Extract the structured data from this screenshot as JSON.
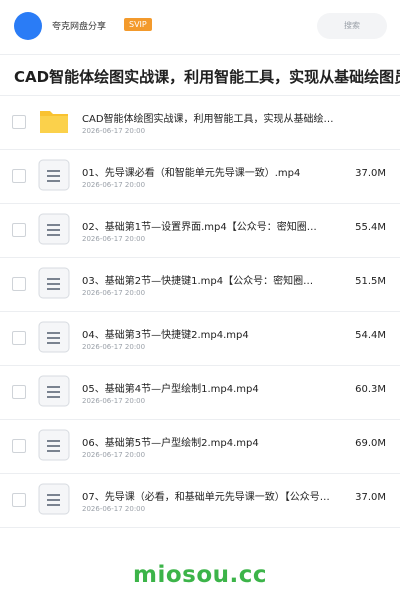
{
  "header": {
    "app_name": "夸克网盘分享",
    "badge": "SVIP",
    "search_placeholder": "搜索"
  },
  "share_title": "CAD智能体绘图实战课，利用智能工具，实现从基础绘图员",
  "files": [
    {
      "type": "folder",
      "name": "CAD智能体绘图实战课，利用智能工具，实现从基础绘…",
      "date": "2026-06-17 20:00",
      "size": ""
    },
    {
      "type": "file",
      "name": "01、先导课必看（和智能单元先导课一致）.mp4",
      "date": "2026-06-17 20:00",
      "size": "37.0M"
    },
    {
      "type": "file",
      "name": "02、基础第1节—设置界面.mp4【公众号：密知圈…",
      "date": "2026-06-17 20:00",
      "size": "55.4M"
    },
    {
      "type": "file",
      "name": "03、基础第2节—快捷键1.mp4【公众号：密知圈…",
      "date": "2026-06-17 20:00",
      "size": "51.5M"
    },
    {
      "type": "file",
      "name": "04、基础第3节—快捷键2.mp4.mp4",
      "date": "2026-06-17 20:00",
      "size": "54.4M"
    },
    {
      "type": "file",
      "name": "05、基础第4节—户型绘制1.mp4.mp4",
      "date": "2026-06-17 20:00",
      "size": "60.3M"
    },
    {
      "type": "file",
      "name": "06、基础第5节—户型绘制2.mp4.mp4",
      "date": "2026-06-17 20:00",
      "size": "69.0M"
    },
    {
      "type": "file",
      "name": "07、先导课（必看，和基础单元先导课一致）【公众号…",
      "date": "2026-06-17 20:00",
      "size": "37.0M"
    }
  ],
  "watermark": "miosou.cc",
  "colors": {
    "avatar": "#2a7cf6",
    "badge": "#f39a2c",
    "folder": "#f9c230",
    "watermark": "#3cb449"
  }
}
